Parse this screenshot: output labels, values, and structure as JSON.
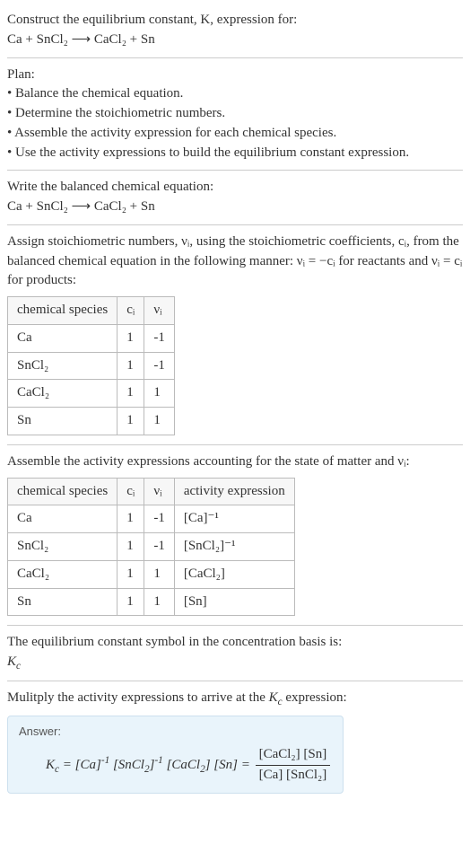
{
  "intro": {
    "line1": "Construct the equilibrium constant, K, expression for:",
    "equation": "Ca + SnCl₂ ⟶ CaCl₂ + Sn"
  },
  "plan": {
    "heading": "Plan:",
    "items": [
      "• Balance the chemical equation.",
      "• Determine the stoichiometric numbers.",
      "• Assemble the activity expression for each chemical species.",
      "• Use the activity expressions to build the equilibrium constant expression."
    ]
  },
  "balanced": {
    "heading": "Write the balanced chemical equation:",
    "equation": "Ca + SnCl₂ ⟶ CaCl₂ + Sn"
  },
  "stoich": {
    "text": "Assign stoichiometric numbers, νᵢ, using the stoichiometric coefficients, cᵢ, from the balanced chemical equation in the following manner: νᵢ = −cᵢ for reactants and νᵢ = cᵢ for products:",
    "headers": [
      "chemical species",
      "cᵢ",
      "νᵢ"
    ],
    "rows": [
      {
        "species": "Ca",
        "c": "1",
        "v": "-1"
      },
      {
        "species": "SnCl₂",
        "c": "1",
        "v": "-1"
      },
      {
        "species": "CaCl₂",
        "c": "1",
        "v": "1"
      },
      {
        "species": "Sn",
        "c": "1",
        "v": "1"
      }
    ]
  },
  "activity": {
    "text": "Assemble the activity expressions accounting for the state of matter and νᵢ:",
    "headers": [
      "chemical species",
      "cᵢ",
      "νᵢ",
      "activity expression"
    ],
    "rows": [
      {
        "species": "Ca",
        "c": "1",
        "v": "-1",
        "expr": "[Ca]⁻¹"
      },
      {
        "species": "SnCl₂",
        "c": "1",
        "v": "-1",
        "expr": "[SnCl₂]⁻¹"
      },
      {
        "species": "CaCl₂",
        "c": "1",
        "v": "1",
        "expr": "[CaCl₂]"
      },
      {
        "species": "Sn",
        "c": "1",
        "v": "1",
        "expr": "[Sn]"
      }
    ]
  },
  "symbol": {
    "text": "The equilibrium constant symbol in the concentration basis is:",
    "sym": "K_c"
  },
  "final": {
    "text": "Mulitply the activity expressions to arrive at the K_c expression:",
    "answer_label": "Answer:",
    "lhs": "K_c = [Ca]⁻¹ [SnCl₂]⁻¹ [CaCl₂] [Sn] =",
    "frac_num": "[CaCl₂] [Sn]",
    "frac_den": "[Ca] [SnCl₂]"
  },
  "chart_data": {
    "type": "table",
    "tables": [
      {
        "title": "Stoichiometric numbers",
        "columns": [
          "chemical species",
          "c_i",
          "ν_i"
        ],
        "rows": [
          [
            "Ca",
            1,
            -1
          ],
          [
            "SnCl2",
            1,
            -1
          ],
          [
            "CaCl2",
            1,
            1
          ],
          [
            "Sn",
            1,
            1
          ]
        ]
      },
      {
        "title": "Activity expressions",
        "columns": [
          "chemical species",
          "c_i",
          "ν_i",
          "activity expression"
        ],
        "rows": [
          [
            "Ca",
            1,
            -1,
            "[Ca]^-1"
          ],
          [
            "SnCl2",
            1,
            -1,
            "[SnCl2]^-1"
          ],
          [
            "CaCl2",
            1,
            1,
            "[CaCl2]"
          ],
          [
            "Sn",
            1,
            1,
            "[Sn]"
          ]
        ]
      }
    ],
    "equilibrium_expression": "K_c = ([CaCl2][Sn]) / ([Ca][SnCl2])"
  }
}
